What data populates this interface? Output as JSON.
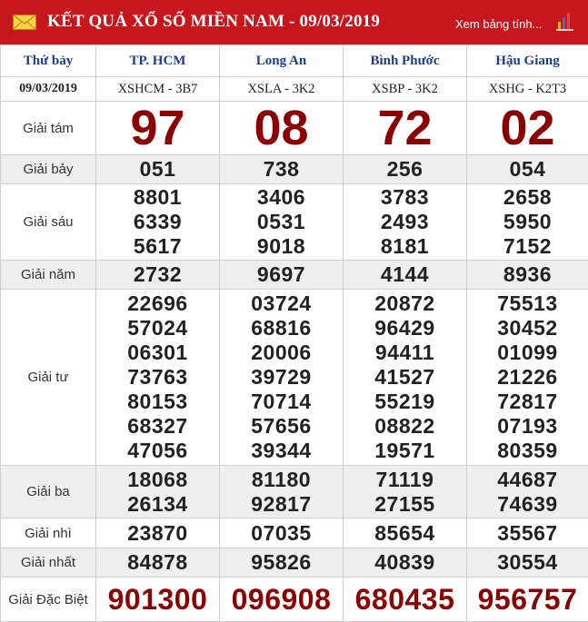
{
  "header": {
    "title": "KẾT QUẢ XỔ SỐ MIỀN NAM - 09/03/2019",
    "view_link": "Xem bảng tính...",
    "colors": {
      "brand": "#c8161d",
      "header_text": "#1e3c8f",
      "highlight_number": "#8b0000"
    },
    "icons": [
      "mail-icon",
      "chart-icon"
    ]
  },
  "table": {
    "day_label": "Thứ bảy",
    "date": "09/03/2019",
    "provinces": [
      {
        "name": "TP. HCM",
        "code": "XSHCM - 3B7"
      },
      {
        "name": "Long An",
        "code": "XSLA - 3K2"
      },
      {
        "name": "Bình Phước",
        "code": "XSBP - 3K2"
      },
      {
        "name": "Hậu Giang",
        "code": "XSHG - K2T3"
      }
    ],
    "prizes": [
      {
        "label": "Giải tám",
        "values": [
          [
            "97"
          ],
          [
            "08"
          ],
          [
            "72"
          ],
          [
            "02"
          ]
        ]
      },
      {
        "label": "Giải bảy",
        "values": [
          [
            "051"
          ],
          [
            "738"
          ],
          [
            "256"
          ],
          [
            "054"
          ]
        ]
      },
      {
        "label": "Giải sáu",
        "values": [
          [
            "8801",
            "6339",
            "5617"
          ],
          [
            "3406",
            "0531",
            "9018"
          ],
          [
            "3783",
            "2493",
            "8181"
          ],
          [
            "2658",
            "5950",
            "7152"
          ]
        ]
      },
      {
        "label": "Giải năm",
        "values": [
          [
            "2732"
          ],
          [
            "9697"
          ],
          [
            "4144"
          ],
          [
            "8936"
          ]
        ]
      },
      {
        "label": "Giải tư",
        "values": [
          [
            "22696",
            "57024",
            "06301",
            "73763",
            "80153",
            "68327",
            "47056"
          ],
          [
            "03724",
            "68816",
            "20006",
            "39729",
            "70714",
            "57656",
            "39344"
          ],
          [
            "20872",
            "96429",
            "94411",
            "41527",
            "55219",
            "08822",
            "19571"
          ],
          [
            "75513",
            "30452",
            "01099",
            "21226",
            "72817",
            "07193",
            "80359"
          ]
        ]
      },
      {
        "label": "Giải ba",
        "values": [
          [
            "18068",
            "26134"
          ],
          [
            "81180",
            "92817"
          ],
          [
            "71119",
            "27155"
          ],
          [
            "44687",
            "74639"
          ]
        ]
      },
      {
        "label": "Giải nhì",
        "values": [
          [
            "23870"
          ],
          [
            "07035"
          ],
          [
            "85654"
          ],
          [
            "35567"
          ]
        ]
      },
      {
        "label": "Giải nhất",
        "values": [
          [
            "84878"
          ],
          [
            "95826"
          ],
          [
            "40839"
          ],
          [
            "30554"
          ]
        ]
      },
      {
        "label": "Giải Đặc Biệt",
        "values": [
          [
            "901300"
          ],
          [
            "096908"
          ],
          [
            "680435"
          ],
          [
            "956757"
          ]
        ]
      }
    ]
  }
}
